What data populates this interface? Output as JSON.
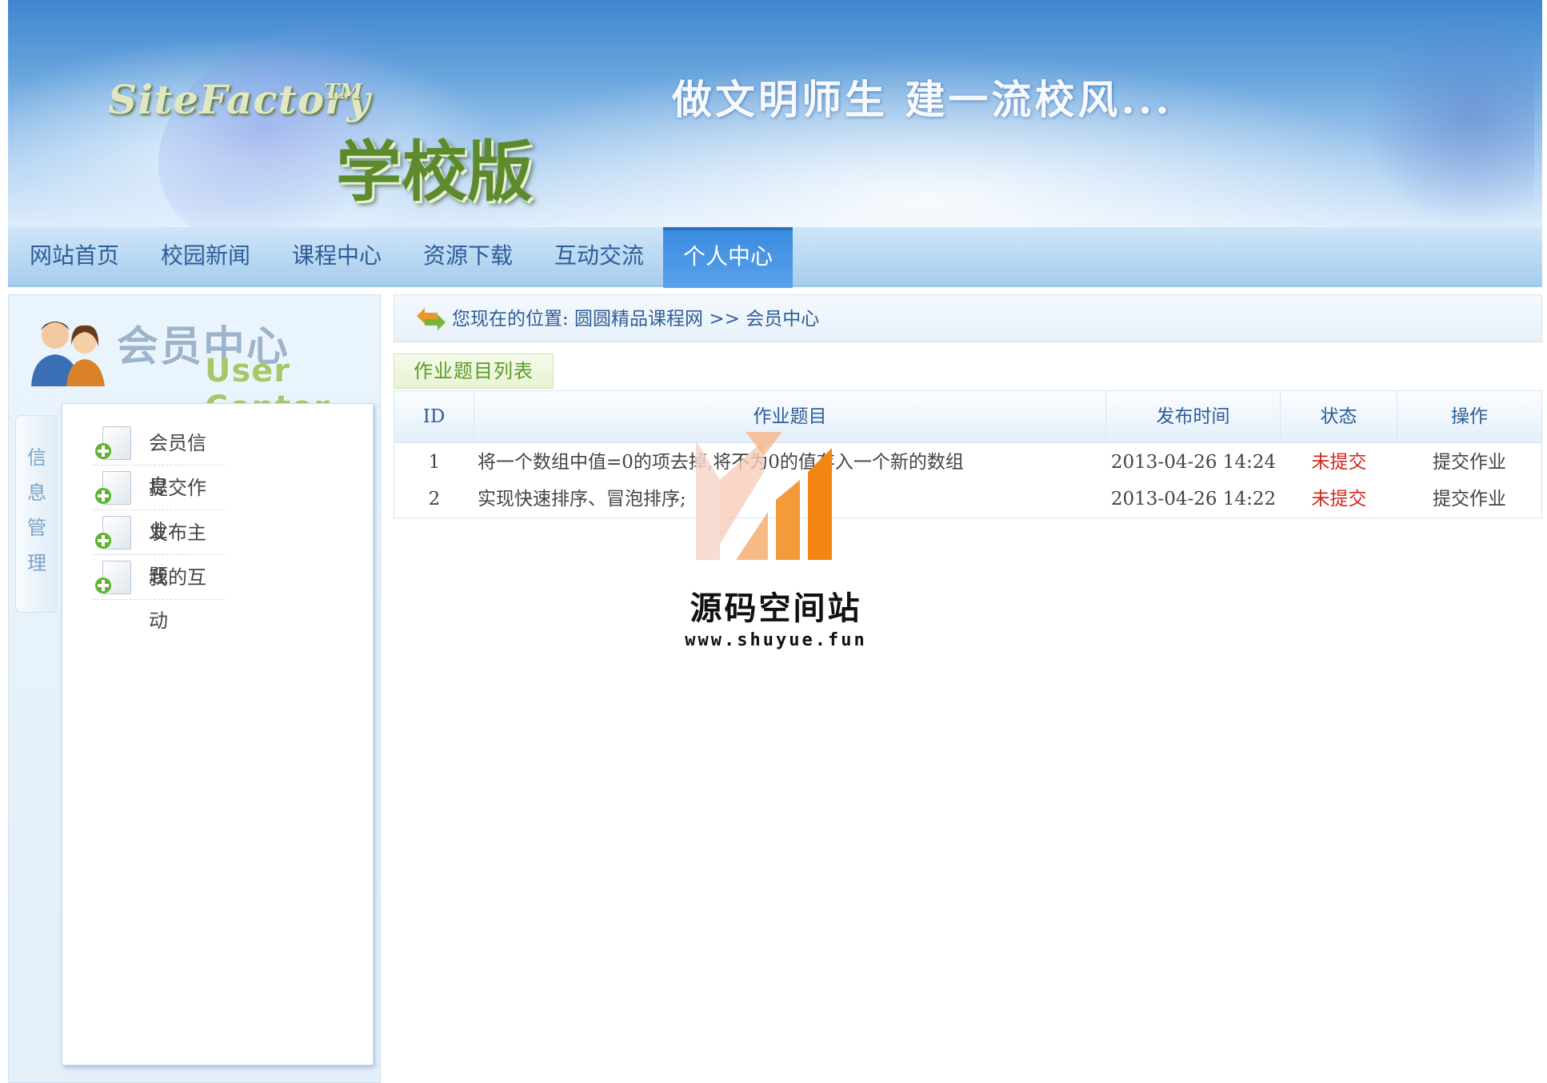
{
  "banner": {
    "logo_en": "SiteFactory",
    "logo_tm": "TM",
    "logo_cn": "学校版",
    "slogan": "做文明师生  建一流校风..."
  },
  "nav": {
    "items": [
      "网站首页",
      "校园新闻",
      "课程中心",
      "资源下载",
      "互动交流",
      "个人中心"
    ],
    "active": "个人中心",
    "active_color": "#3a8be0"
  },
  "user_center": {
    "title_cn": "会员中心",
    "title_en": "User Center",
    "side_tab": [
      "信",
      "息",
      "管",
      "理"
    ],
    "menu": [
      "会员信息",
      "提交作业",
      "发布主题",
      "我的互动"
    ],
    "menu_icon": "document-add-icon"
  },
  "breadcrumb": {
    "text": "您现在的位置: 圆圆精品课程网 >> 会员中心",
    "icon": "swap-arrow-icon"
  },
  "homework": {
    "tab_title": "作业题目列表",
    "columns": [
      "ID",
      "作业题目",
      "发布时间",
      "状态",
      "操作"
    ],
    "rows": [
      {
        "id": "1",
        "title": "将一个数组中值=0的项去掉,将不为0的值存入一个新的数组",
        "time": "2013-04-26 14:24",
        "status": "未提交",
        "action": "提交作业"
      },
      {
        "id": "2",
        "title": "实现快速排序、冒泡排序;",
        "time": "2013-04-26 14:22",
        "status": "未提交",
        "action": "提交作业"
      }
    ],
    "status_color": "#d0281f"
  },
  "watermark": {
    "name": "源码空间站",
    "url": "www.shuyue.fun"
  }
}
